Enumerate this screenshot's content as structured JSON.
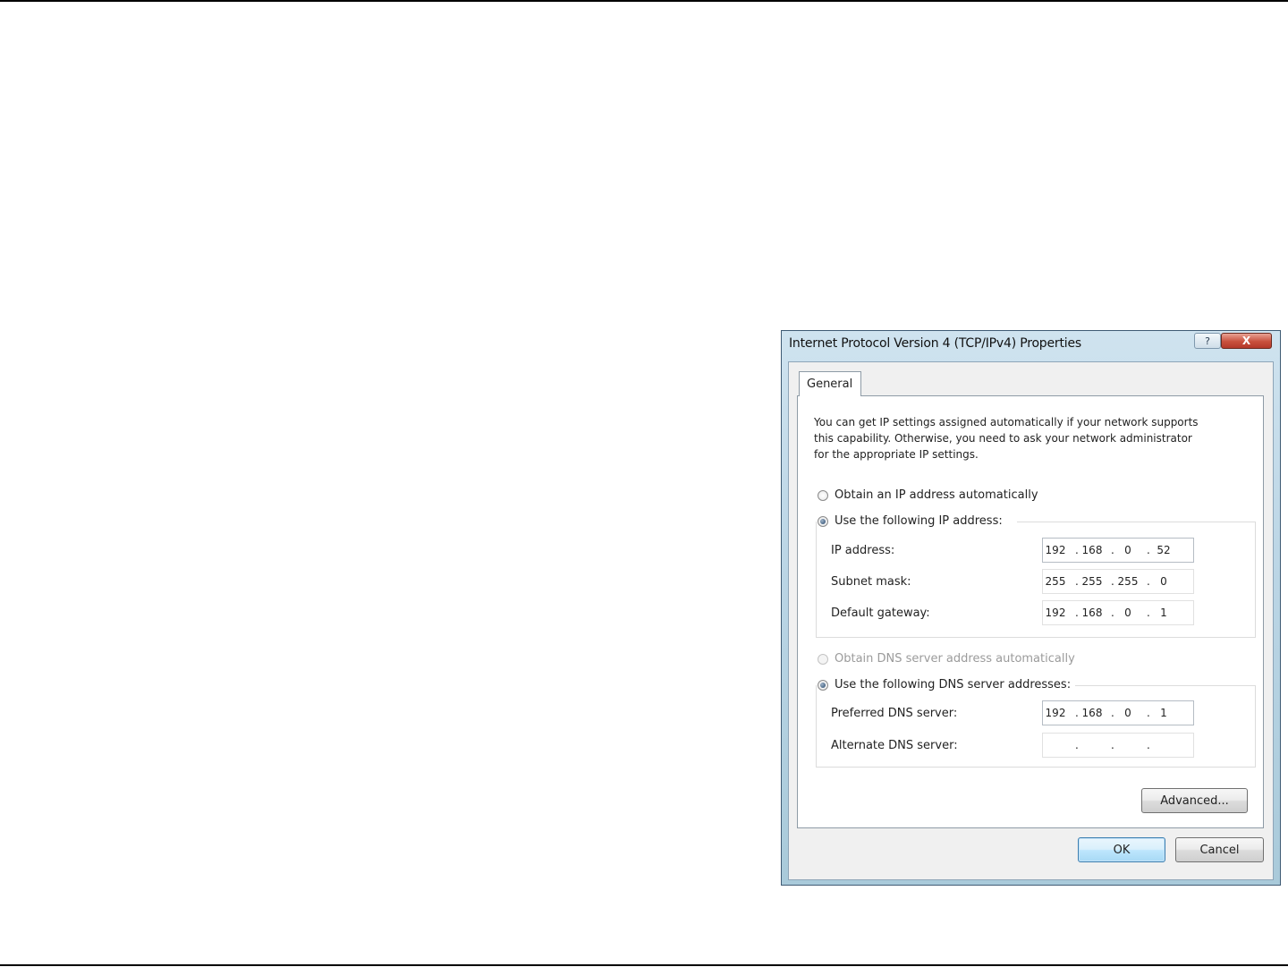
{
  "dialog": {
    "title": "Internet Protocol Version 4 (TCP/IPv4) Properties",
    "help_glyph": "?",
    "close_glyph": "X",
    "tab": "General",
    "description": [
      "You can get IP settings assigned automatically if your network supports",
      "this capability. Otherwise, you need to ask your network administrator",
      "for the appropriate IP settings."
    ],
    "ip_mode": {
      "auto_label": "Obtain an IP address automatically",
      "manual_label": "Use the following IP address:",
      "selected": "manual"
    },
    "ip_fields": [
      {
        "label": "IP address:",
        "octets": [
          "192",
          "168",
          "0",
          "52"
        ]
      },
      {
        "label": "Subnet mask:",
        "octets": [
          "255",
          "255",
          "255",
          "0"
        ]
      },
      {
        "label": "Default gateway:",
        "octets": [
          "192",
          "168",
          "0",
          "1"
        ]
      }
    ],
    "dns_mode": {
      "auto_label": "Obtain DNS server address automatically",
      "manual_label": "Use the following DNS server addresses:",
      "selected": "manual",
      "auto_disabled": true
    },
    "dns_fields": [
      {
        "label": "Preferred DNS server:",
        "octets": [
          "192",
          "168",
          "0",
          "1"
        ]
      },
      {
        "label": "Alternate DNS server:",
        "octets": [
          "",
          "",
          "",
          ""
        ]
      }
    ],
    "advanced_label": "Advanced...",
    "ok_label": "OK",
    "cancel_label": "Cancel"
  }
}
